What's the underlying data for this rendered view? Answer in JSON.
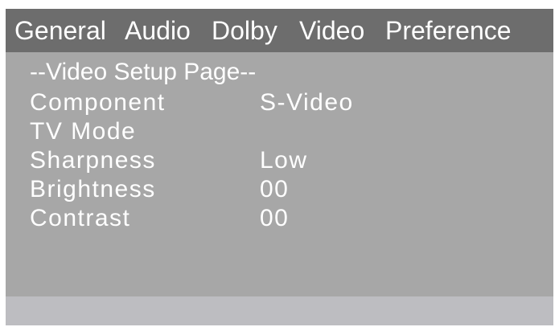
{
  "tabs": [
    {
      "label": "General"
    },
    {
      "label": "Audio"
    },
    {
      "label": "Dolby"
    },
    {
      "label": "Video"
    },
    {
      "label": "Preference"
    }
  ],
  "page_title": "--Video Setup Page--",
  "settings": [
    {
      "label": "Component",
      "value": "S-Video"
    },
    {
      "label": "TV Mode",
      "value": ""
    },
    {
      "label": "Sharpness",
      "value": "Low"
    },
    {
      "label": "Brightness",
      "value": "00"
    },
    {
      "label": "Contrast",
      "value": "00"
    }
  ],
  "colors": {
    "tab_bar": "#6d6d6d",
    "panel": "#a7a7a7",
    "footer": "#bdbdc1",
    "text": "#ffffff"
  }
}
